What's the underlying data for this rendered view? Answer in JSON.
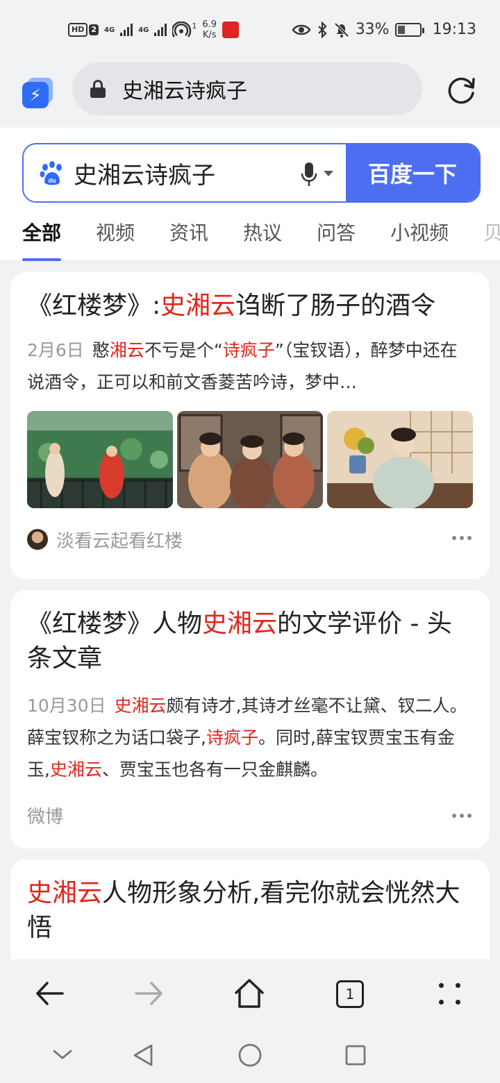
{
  "status_bar": {
    "hd_label": "HD",
    "sim_label": "2",
    "net1": "4G",
    "net2": "4G",
    "hotspot_sup": "1",
    "speed_value": "6.9",
    "speed_unit": "K/s",
    "battery_percent": "33%",
    "battery_level": 0.33,
    "time": "19:13"
  },
  "browser": {
    "app_logo_icon": "lightning-icon",
    "url_text": "史湘云诗疯子"
  },
  "search": {
    "query": "史湘云诗疯子",
    "button_label": "百度一下",
    "brand_color": "#4e6ef2"
  },
  "tabs": [
    {
      "label": "全部",
      "active": true
    },
    {
      "label": "视频"
    },
    {
      "label": "资讯"
    },
    {
      "label": "热议"
    },
    {
      "label": "问答"
    },
    {
      "label": "小视频"
    },
    {
      "label": "贝"
    }
  ],
  "results": [
    {
      "title_pre": "《红楼梦》:",
      "title_hl": "史湘云",
      "title_post": "诌断了肠子的酒令",
      "date": "2月6日",
      "snippet_a": "憨",
      "snippet_hl1": "湘云",
      "snippet_b": "不亏是个“",
      "snippet_hl2": "诗疯子",
      "snippet_c": "”（宝钗语），醉梦中还在说酒令，正可以和前文香菱苦吟诗，梦中…",
      "source": "淡看云起看红楼"
    },
    {
      "title_pre": "《红楼梦》人物",
      "title_hl": "史湘云",
      "title_post": "的文学评价 - 头条文章",
      "date": "10月30日",
      "snippet_hl1": "史湘云",
      "snippet_a": "颇有诗才,其诗才丝毫不让黛、钗二人。薛宝钗称之为话口袋子,",
      "snippet_hl2": "诗疯子",
      "snippet_b": "。同时,薛宝钗贾宝玉有金玉,",
      "snippet_hl3": "史湘云",
      "snippet_c": "、贾宝玉也各有一只金麒麟。",
      "source": "微博"
    },
    {
      "title_hl": "史湘云",
      "title_post": "人物形象分析,看完你就会恍然大悟"
    }
  ],
  "colors": {
    "highlight": "#e1251b",
    "page_bg": "#f1f2f4"
  }
}
